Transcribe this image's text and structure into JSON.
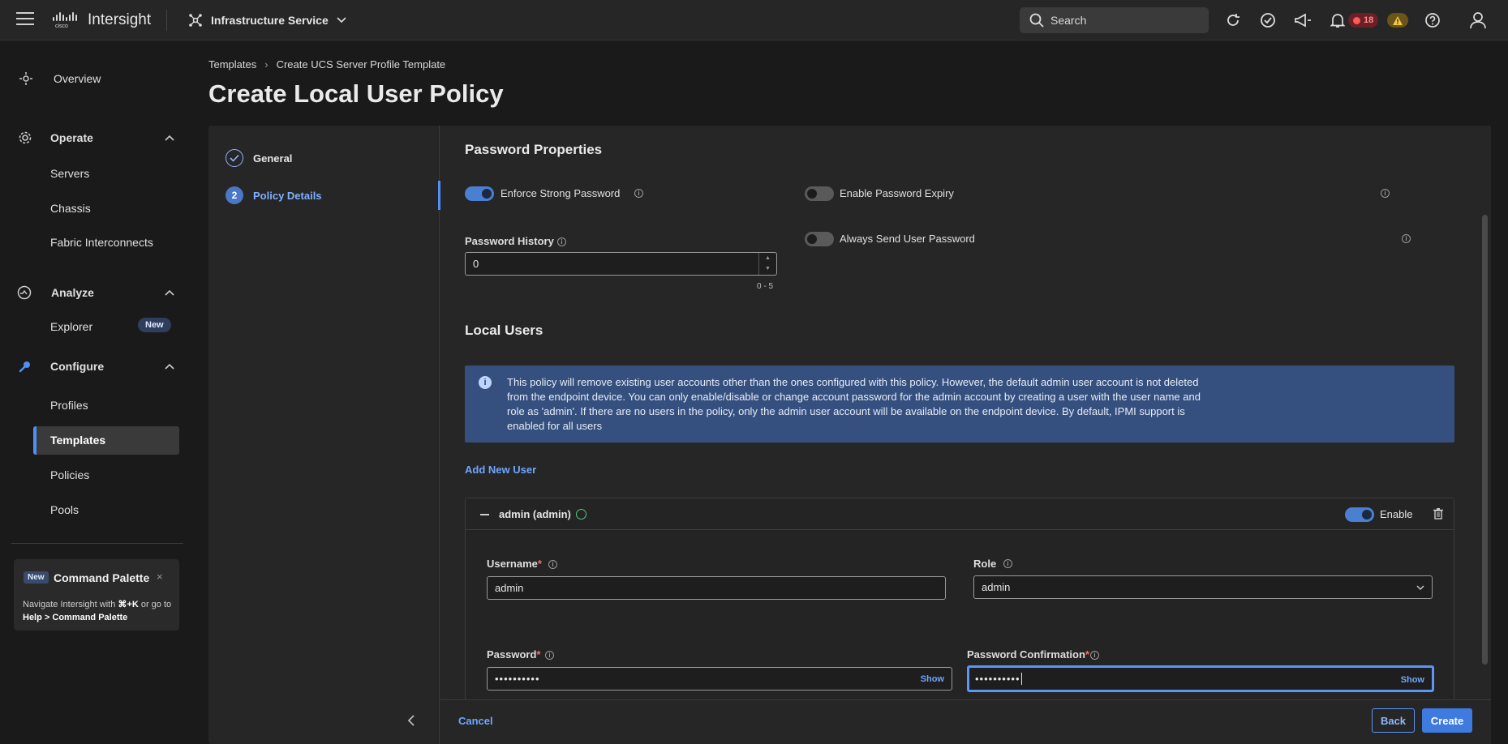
{
  "topbar": {
    "brand": "Intersight",
    "service": "Infrastructure Service",
    "search_label": "Search",
    "alerts_critical": "18",
    "icons": [
      "menu-icon",
      "cisco-logo",
      "services-icon",
      "chevron-down-icon",
      "search-icon",
      "refresh-icon",
      "tasks-icon",
      "announcements-icon",
      "bell-icon",
      "warning-icon",
      "help-icon",
      "user-icon"
    ]
  },
  "nav": {
    "overview": "Overview",
    "operate": "Operate",
    "operate_items": [
      "Servers",
      "Chassis",
      "Fabric Interconnects"
    ],
    "analyze": "Analyze",
    "explorer": "Explorer",
    "new_badge": "New",
    "configure": "Configure",
    "configure_items": [
      "Profiles",
      "Templates",
      "Policies",
      "Pools"
    ],
    "active": "Templates",
    "command_palette": {
      "badge": "New",
      "title": "Command Palette",
      "close": "×",
      "desc_1": "Navigate Intersight with ",
      "shortcut": "⌘+K",
      "desc_2": " or go to ",
      "path": "Help > Command Palette"
    }
  },
  "breadcrumb": {
    "items": [
      "Templates",
      "Create UCS Server Profile Template"
    ],
    "sep": "›"
  },
  "page_title": "Create Local User Policy",
  "wizard": {
    "steps": [
      {
        "num": "✓",
        "label": "General"
      },
      {
        "num": "2",
        "label": "Policy Details"
      }
    ],
    "active_step": 1
  },
  "password_properties": {
    "title": "Password Properties",
    "enforce_strong": {
      "label": "Enforce Strong Password",
      "on": true
    },
    "enable_expiry": {
      "label": "Enable Password Expiry",
      "on": false
    },
    "always_send": {
      "label": "Always Send User Password",
      "on": false
    },
    "history": {
      "label": "Password History",
      "value": "0",
      "range": "0 - 5"
    }
  },
  "local_users": {
    "title": "Local Users",
    "banner": "This policy will remove existing user accounts other than the ones configured with this policy. However, the default admin user account is not deleted from the endpoint device. You can only enable/disable or change account password for the admin account by creating a user with the user name and role as 'admin'. If there are no users in the policy, only the admin user account will be available on the endpoint device. By default, IPMI support is enabled for all users",
    "add_user": "Add New User",
    "user": {
      "title": "admin (admin)",
      "enable_label": "Enable",
      "enabled": true,
      "username_label": "Username",
      "username": "admin",
      "role_label": "Role",
      "role": "admin",
      "password_label": "Password",
      "password_mask": "••••••••••",
      "confirm_label": "Password Confirmation",
      "confirm_mask": "••••••••••",
      "show": "Show",
      "required_mark": "*"
    }
  },
  "footer": {
    "cancel": "Cancel",
    "back": "Back",
    "create": "Create"
  }
}
